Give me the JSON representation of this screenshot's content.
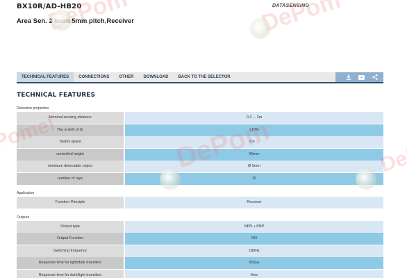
{
  "header": {
    "product_code": "BX10R/AD-HB20",
    "product_description": "Area Sen. 2  0mm  5mm pitch,Receiver",
    "brand": "DATASENSING"
  },
  "tabs": [
    {
      "label": "TECHNICAL FEATURES",
      "active": true
    },
    {
      "label": "CONNECTIONS",
      "active": false
    },
    {
      "label": "OTHER",
      "active": false
    },
    {
      "label": "DOWNLOAD",
      "active": false
    },
    {
      "label": "BACK TO THE SELECTOR",
      "active": false
    }
  ],
  "tab_icons": [
    "download-icon",
    "video-icon",
    "share-icon"
  ],
  "section_title": "TECHNICAL FEATURES",
  "groups": [
    {
      "label": "Detection properties",
      "rows": [
        {
          "label": "Nominal sensing distance",
          "value": "0,3 ... 2m"
        },
        {
          "label": "The  al drift of Sr",
          "value": "≤10%"
        },
        {
          "label": "Teams space",
          "value": "On ..."
        },
        {
          "label": "controlled height",
          "value": "90mm"
        },
        {
          "label": "minimum detectable object",
          "value": "Ø 5mm"
        },
        {
          "label": "number of rays",
          "value": "10"
        }
      ]
    },
    {
      "label": "Application",
      "rows": [
        {
          "label": "Function Principle",
          "value": "Receiver"
        }
      ]
    },
    {
      "label": "Outputs",
      "rows": [
        {
          "label": "Output type",
          "value": "NPN + PNP"
        },
        {
          "label": "Output Function",
          "value": "NO"
        },
        {
          "label": "Switching frequency",
          "value": "180Hz"
        },
        {
          "label": "Response time for light/dark transition",
          "value": "500µs"
        },
        {
          "label": "Response time for dark/light transition",
          "value": "9ms"
        }
      ]
    }
  ],
  "watermarks": [
    "DePom",
    "DePom",
    "DePom",
    "Pomel",
    "Del"
  ],
  "colors": {
    "tab_underline": "#2d4d6e",
    "row_value_light": "#d9e7f5",
    "row_value_dark": "#8ecae6",
    "row_label": "#dcdcdc"
  }
}
